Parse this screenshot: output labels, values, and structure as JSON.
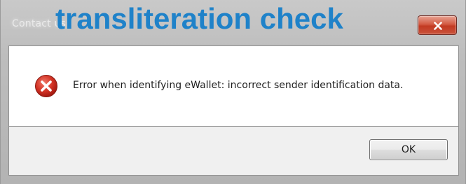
{
  "dialog": {
    "title": "Contact us",
    "overlay_caption": "transliteration check",
    "close_icon": "close-icon",
    "error_icon": "error-icon",
    "message": "Error when identifying eWallet: incorrect sender identification data.",
    "ok_label": "OK"
  },
  "colors": {
    "overlay_text": "#1f82c9",
    "close_button": "#c23a22",
    "error_icon": "#c8261c"
  }
}
